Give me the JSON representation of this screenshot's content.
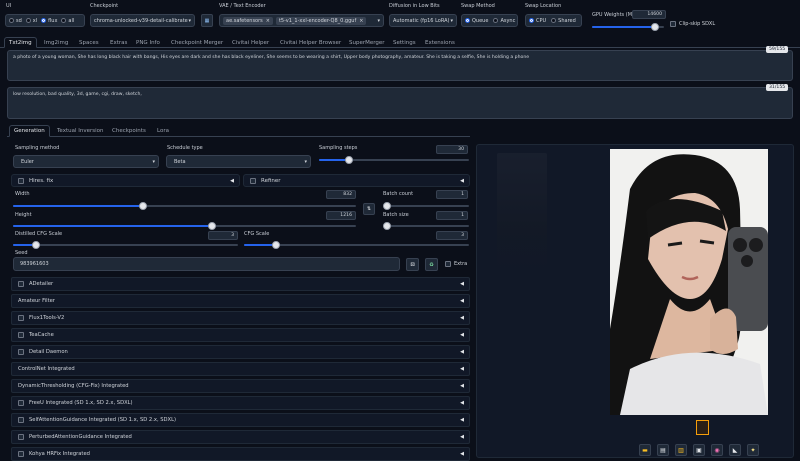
{
  "top": {
    "ui_label": "UI",
    "ui_options": [
      "sd",
      "xl",
      "flux",
      "all"
    ],
    "ui_selected": "flux",
    "checkpoint_label": "Checkpoint",
    "checkpoint_value": "chroma-unlocked-v39-detail-calibrated-fp8",
    "vae_label": "VAE / Text Encoder",
    "vae_value_1": "ae.safetensors",
    "vae_value_2": "t5-v1_1-xxl-encoder-Q8_0.gguf",
    "diffusion_label": "Diffusion in Low Bits",
    "diffusion_value": "Automatic (fp16 LoRA)",
    "swap_method_label": "Swap Method",
    "swap_method_options": [
      "Queue",
      "Async"
    ],
    "swap_location_label": "Swap Location",
    "swap_location_options": [
      "CPU",
      "Shared"
    ],
    "gpu_weights_label": "GPU Weights (MB)",
    "gpu_weights_value": "14600",
    "gpu_weights_fraction": 0.88,
    "clip_skip_label": "Clip-skip SDXL"
  },
  "tabs": [
    "Txt2img",
    "Img2img",
    "Spaces",
    "Extras",
    "PNG Info",
    "Checkpoint Merger",
    "Civitai Helper",
    "Civitai Helper Browser",
    "SuperMerger",
    "Settings",
    "Extensions"
  ],
  "prompt": {
    "positive": "a photo of a young woman, She has long black hair with bangs, His eyes are dark and she has black eyeliner, She seems to be wearing a shirt, Upper body photography, amateur. She is taking a selfie, She is holding a phone",
    "positive_count": "59/155",
    "negative": "low resolution, bad quality, 3d, game, cgi, draw, sketch,",
    "negative_count": "31/155"
  },
  "subtabs": [
    "Generation",
    "Textual Inversion",
    "Checkpoints",
    "Lora"
  ],
  "gen": {
    "sampling_method_label": "Sampling method",
    "sampling_method_value": "Euler",
    "schedule_type_label": "Schedule type",
    "schedule_type_value": "Beta",
    "sampling_steps_label": "Sampling steps",
    "sampling_steps_value": "30",
    "sampling_steps_fraction": 0.2,
    "hires_label": "Hires. fix",
    "refiner_label": "Refiner",
    "width_label": "Width",
    "width_value": "832",
    "width_fraction": 0.38,
    "height_label": "Height",
    "height_value": "1216",
    "height_fraction": 0.58,
    "batch_count_label": "Batch count",
    "batch_count_value": "1",
    "batch_size_label": "Batch size",
    "batch_size_value": "1",
    "distilled_cfg_label": "Distilled CFG Scale",
    "distilled_cfg_value": "3",
    "distilled_cfg_fraction": 0.1,
    "cfg_label": "CFG Scale",
    "cfg_value": "3",
    "cfg_fraction": 0.14,
    "seed_label": "Seed",
    "seed_value": "983961603",
    "extra_label": "Extra"
  },
  "accordions": [
    {
      "label": "ADetailer",
      "checkbox": true
    },
    {
      "label": "Amateur Filter",
      "checkbox": false
    },
    {
      "label": "Flux1Tools-V2",
      "checkbox": true
    },
    {
      "label": "TeaCache",
      "checkbox": true
    },
    {
      "label": "Detail Daemon",
      "checkbox": true
    },
    {
      "label": "ControlNet Integrated",
      "checkbox": false
    },
    {
      "label": "DynamicThresholding (CFG-Fix) Integrated",
      "checkbox": false
    },
    {
      "label": "FreeU Integrated (SD 1.x, SD 2.x, SDXL)",
      "checkbox": true
    },
    {
      "label": "SelfAttentionGuidance Integrated (SD 1.x, SD 2.x, SDXL)",
      "checkbox": true
    },
    {
      "label": "PerturbedAttentionGuidance Integrated",
      "checkbox": true
    },
    {
      "label": "Kohya HRFix Integrated",
      "checkbox": true
    }
  ],
  "icons": {
    "swap_dims": "swap-icon",
    "dice": "dice-icon",
    "recycle": "recycle-icon",
    "refresh": "refresh-icon",
    "collapse": "triangle-icon"
  },
  "colors": {
    "accent": "#2563eb",
    "bg": "#0b0f19",
    "panel": "#1f2937"
  }
}
